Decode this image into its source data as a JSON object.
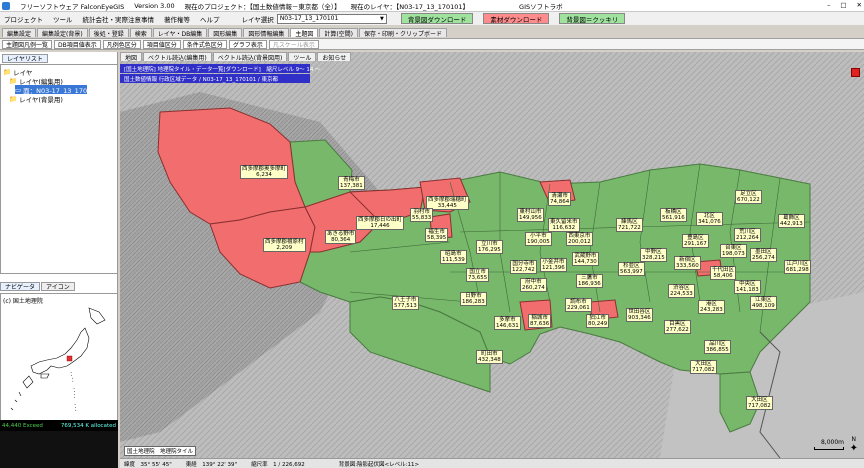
{
  "title": {
    "app": "フリーソフトウェア FalconEyeGIS",
    "version": "Version 3.00",
    "project": "現在のプロジェクト：【国土数値情報－東京都（全）】",
    "layer": "現在のレイヤ：【N03-17_13_170101】",
    "vendor": "GISソフトラボ"
  },
  "menu": [
    "プロジェクト",
    "ツール",
    "統計会社・実際注意事情",
    "著作権等",
    "ヘルプ"
  ],
  "layer_select": {
    "label": "レイヤ選択",
    "value": "N03-17_13_170101"
  },
  "download_buttons": [
    {
      "label": "背景図ダウンロード",
      "color": "#9fe39f"
    },
    {
      "label": "素材ダウンロード",
      "color": "#ff8c8c"
    },
    {
      "label": "背景図＝クッキリ",
      "color": "#9fe39f"
    }
  ],
  "tabs1": [
    "編集設定",
    "編集設定(背景)",
    "",
    "スケール表示"
  ],
  "tabs1_real": [
    "編集設定",
    "編集設定(背景)",
    "後処・登録",
    "検索",
    "レイヤ・DB編集",
    "図形編集",
    "図形情報編集",
    "主題図",
    "計算(空間)",
    "保存・印刷・クリップボード"
  ],
  "toolbar": [
    "主題図凡例一覧",
    "DB項目値表示",
    "凡例色区分",
    "項目値区分",
    "条件式色区分",
    "グラフ表示",
    "凡スケール表示"
  ],
  "left": {
    "tab": "レイヤリスト",
    "tree": [
      {
        "label": "レイヤ",
        "indent": 0
      },
      {
        "label": "レイヤ(編集用)",
        "indent": 1
      },
      {
        "label": "面：N03-17_13_170101",
        "indent": 2,
        "selected": true
      },
      {
        "label": "レイヤ(背景用)",
        "indent": 1
      }
    ],
    "nav_tabs": [
      "ナビゲータ",
      "アイコン"
    ],
    "nav_credit": "(c) 国土地理院",
    "status_left": "44,440 Exceed",
    "status_right": "769,534 K allocated"
  },
  "map": {
    "tabs": [
      "地図",
      "ベクトル読込(編集用)",
      "ベクトル読込(背景図用)",
      "ツール",
      "お知らせ"
    ],
    "bluebar1": "[国土地理院] 地理院タイル・データ一覧[ダウンロード]　縮尺レベル 9～ 14 ～",
    "bluebar2": "国土数値情報 行政区域データ / N03-17_13_170101 / 東京都",
    "credit": "国土地理院　地理院タイル",
    "scale": "8,000m",
    "compass": "N"
  },
  "labels": [
    {
      "name": "西多摩郡奥多摩町",
      "value": "6,234"
    },
    {
      "name": "青梅市",
      "value": "137,381"
    },
    {
      "name": "西多摩郡檜原村",
      "value": "2,209"
    },
    {
      "name": "あきる野市",
      "value": "80,364"
    },
    {
      "name": "西多摩郡日の出町",
      "value": "17,446"
    },
    {
      "name": "西多摩郡瑞穂町",
      "value": "33,445"
    },
    {
      "name": "羽村市",
      "value": "55,833"
    },
    {
      "name": "福生市",
      "value": "58,395"
    },
    {
      "name": "清瀬市",
      "value": "74,864"
    },
    {
      "name": "東村山市",
      "value": "149,956"
    },
    {
      "name": "東久留米市",
      "value": "116,632"
    },
    {
      "name": "小平市",
      "value": "190,005"
    },
    {
      "name": "西東京市",
      "value": "200,012"
    },
    {
      "name": "練馬区",
      "value": "721,722"
    },
    {
      "name": "板橋区",
      "value": "561,916"
    },
    {
      "name": "北区",
      "value": "341,076"
    },
    {
      "name": "足立区",
      "value": "670,122"
    },
    {
      "name": "葛飾区",
      "value": "442,913"
    },
    {
      "name": "荒川区",
      "value": "212,264"
    },
    {
      "name": "豊島区",
      "value": "291,167"
    },
    {
      "name": "台東区",
      "value": "198,073"
    },
    {
      "name": "墨田区",
      "value": "256,274"
    },
    {
      "name": "江戸川区",
      "value": "681,298"
    },
    {
      "name": "立川市",
      "value": "176,295"
    },
    {
      "name": "昭島市",
      "value": "111,539"
    },
    {
      "name": "国立市",
      "value": "73,655"
    },
    {
      "name": "国分寺市",
      "value": "122,742"
    },
    {
      "name": "小金井市",
      "value": "121,396"
    },
    {
      "name": "武蔵野市",
      "value": "144,730"
    },
    {
      "name": "中野区",
      "value": "328,215"
    },
    {
      "name": "新宿区",
      "value": "333,560"
    },
    {
      "name": "杉並区",
      "value": "563,997"
    },
    {
      "name": "千代田区",
      "value": "58,406"
    },
    {
      "name": "中央区",
      "value": "141,183"
    },
    {
      "name": "三鷹市",
      "value": "186,936"
    },
    {
      "name": "府中市",
      "value": "260,274"
    },
    {
      "name": "調布市",
      "value": "229,061"
    },
    {
      "name": "渋谷区",
      "value": "224,533"
    },
    {
      "name": "港区",
      "value": "243,283"
    },
    {
      "name": "世田谷区",
      "value": "903,346"
    },
    {
      "name": "目黒区",
      "value": "277,622"
    },
    {
      "name": "日野市",
      "value": "186,283"
    },
    {
      "name": "八王子市",
      "value": "577,513"
    },
    {
      "name": "多摩市",
      "value": "146,631"
    },
    {
      "name": "稲城市",
      "value": "87,636"
    },
    {
      "name": "狛江市",
      "value": "80,249"
    },
    {
      "name": "町田市",
      "value": "432,348"
    },
    {
      "name": "品川区",
      "value": "386,855"
    },
    {
      "name": "大田区",
      "value": "717,082"
    },
    {
      "name": "江東区",
      "value": "498,109"
    },
    {
      "name": "大田区",
      "value": "717,082"
    }
  ],
  "status": {
    "lat": "緯度　35° 55' 45\"",
    "lon": "東経　139° 22' 39\"",
    "scale": "縮尺率　1 / 226,692",
    "bg": "背景図:陰影起伏図<レベル:11>"
  }
}
